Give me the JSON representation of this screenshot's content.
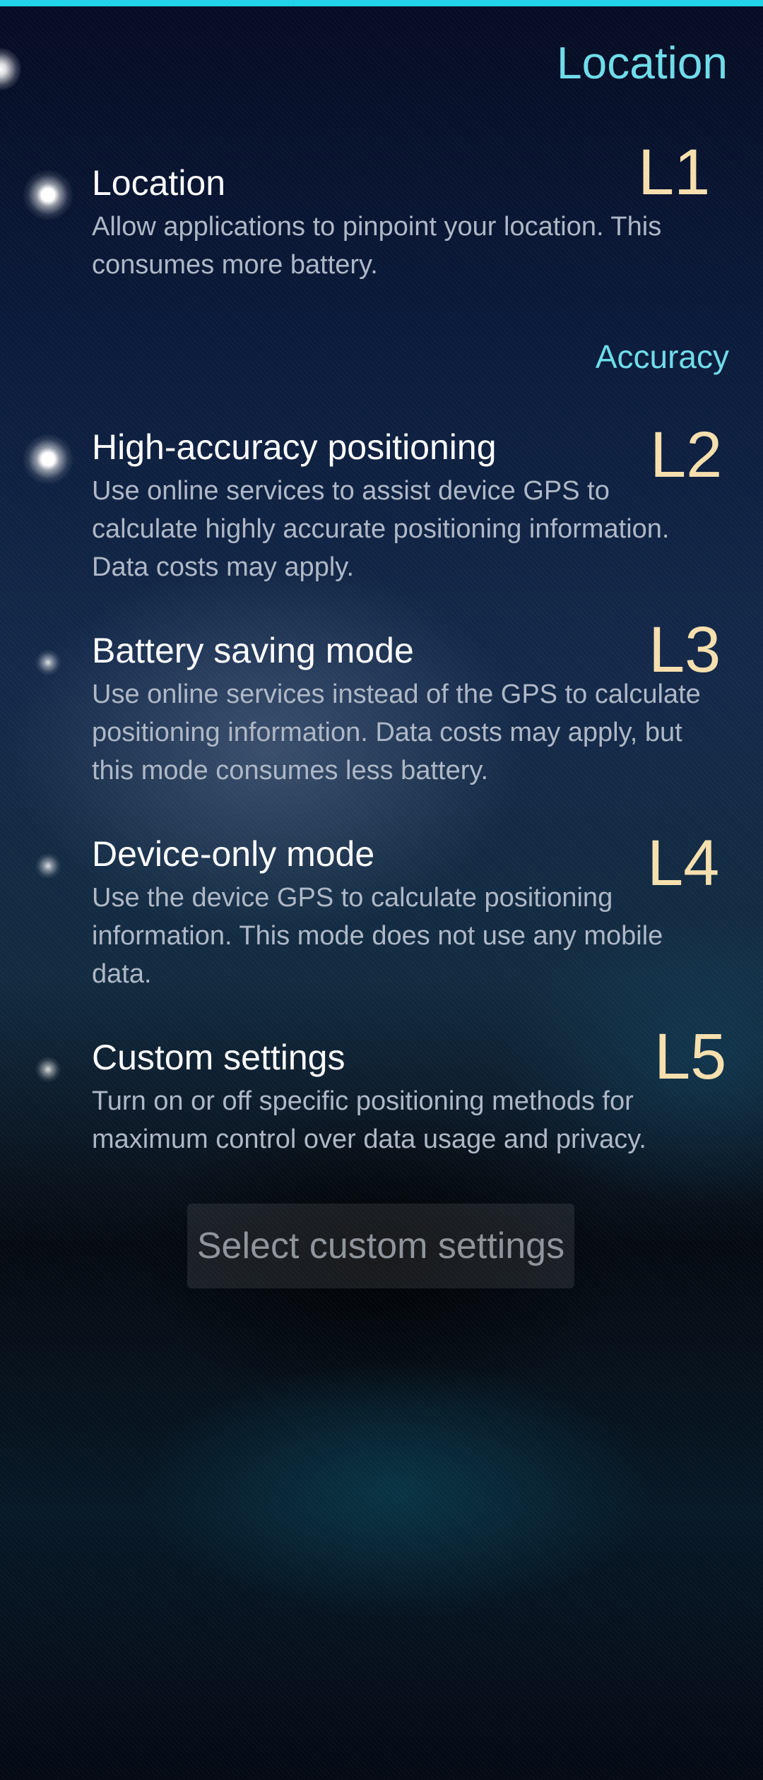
{
  "header": {
    "title": "Location"
  },
  "master": {
    "title": "Location",
    "description": "Allow applications to pinpoint your location. This consumes more battery.",
    "tag": "L1",
    "enabled": true
  },
  "section": {
    "header": "Accuracy"
  },
  "modes": [
    {
      "title": "High-accuracy positioning",
      "description": "Use online services to assist device GPS to calculate highly accurate positioning information. Data costs may apply.",
      "tag": "L2",
      "selected": true
    },
    {
      "title": "Battery saving mode",
      "description": "Use online services instead of the GPS to calculate positioning information. Data costs may apply, but this mode consumes less battery.",
      "tag": "L3",
      "selected": false
    },
    {
      "title": "Device-only mode",
      "description": "Use the device GPS to calculate positioning information. This mode does not use any mobile data.",
      "tag": "L4",
      "selected": false
    },
    {
      "title": "Custom settings",
      "description": "Turn on or off specific positioning methods for maximum control over data usage and privacy.",
      "tag": "L5",
      "selected": false
    }
  ],
  "custom_button": {
    "label": "Select custom settings"
  },
  "colors": {
    "accent": "#1fd3e8",
    "highlight": "#6fdce9",
    "tag": "#f6dfad",
    "primary_text": "#ffffff",
    "secondary_text": "#aeb7c6"
  }
}
